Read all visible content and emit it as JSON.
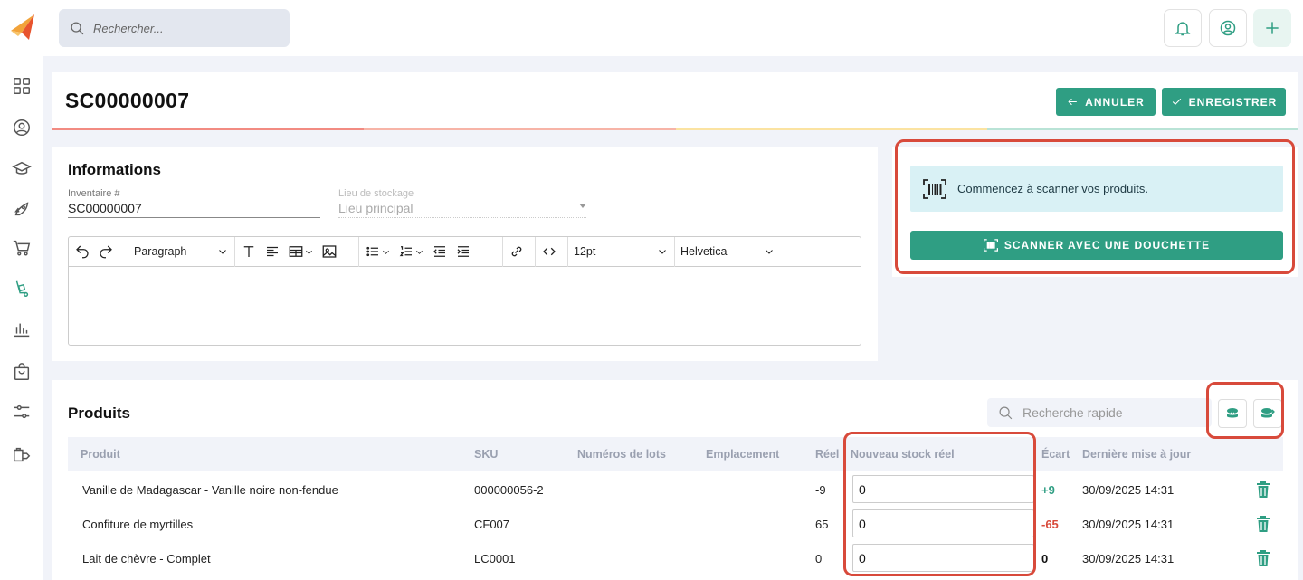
{
  "app": {
    "search_placeholder": "Rechercher..."
  },
  "sidebar": {
    "items": [
      {
        "icon": "grid-icon"
      },
      {
        "icon": "user-circle-icon"
      },
      {
        "icon": "graduation-cap-icon"
      },
      {
        "icon": "rocket-icon"
      },
      {
        "icon": "cart-icon"
      },
      {
        "icon": "stock-icon",
        "active": true
      },
      {
        "icon": "bar-chart-icon"
      },
      {
        "icon": "bag-icon"
      },
      {
        "icon": "sliders-icon"
      },
      {
        "icon": "box-export-icon"
      }
    ]
  },
  "header": {
    "title": "SC00000007",
    "cancel_label": "ANNULER",
    "save_label": "ENREGISTRER",
    "accent_colors": [
      "#f28b82",
      "#f7b4a7",
      "#fbe3a1",
      "#b9e3d6"
    ]
  },
  "info": {
    "title": "Informations",
    "inventory_label": "Inventaire #",
    "inventory_value": "SC00000007",
    "location_label": "Lieu de stockage",
    "location_value": "Lieu principal",
    "editor": {
      "paragraph": "Paragraph",
      "font_size": "12pt",
      "font_family": "Helvetica"
    }
  },
  "scan": {
    "message": "Commencez à scanner vos produits.",
    "button_label": "SCANNER AVEC UNE DOUCHETTE"
  },
  "products": {
    "title": "Produits",
    "search_placeholder": "Recherche rapide",
    "columns": {
      "product": "Produit",
      "sku": "SKU",
      "lots": "Numéros de lots",
      "location": "Emplacement",
      "real": "Réel",
      "new_stock": "Nouveau stock réel",
      "gap": "Écart",
      "updated": "Dernière mise à jour"
    },
    "rows": [
      {
        "product": "Vanille de Madagascar - Vanille noire non-fendue",
        "sku": "000000056-2",
        "real": "-9",
        "new_stock": "0",
        "gap": "+9",
        "gap_color": "#2f9e83",
        "updated": "30/09/2025 14:31"
      },
      {
        "product": "Confiture de myrtilles",
        "sku": "CF007",
        "real": "65",
        "new_stock": "0",
        "gap": "-65",
        "gap_color": "#d84a3b",
        "updated": "30/09/2025 14:31"
      },
      {
        "product": "Lait de chèvre - Complet",
        "sku": "LC0001",
        "real": "0",
        "new_stock": "0",
        "gap": "0",
        "gap_color": "#111111",
        "updated": "30/09/2025 14:31"
      }
    ]
  },
  "colors": {
    "accent": "#2f9e83",
    "highlight": "#d84a3b"
  }
}
